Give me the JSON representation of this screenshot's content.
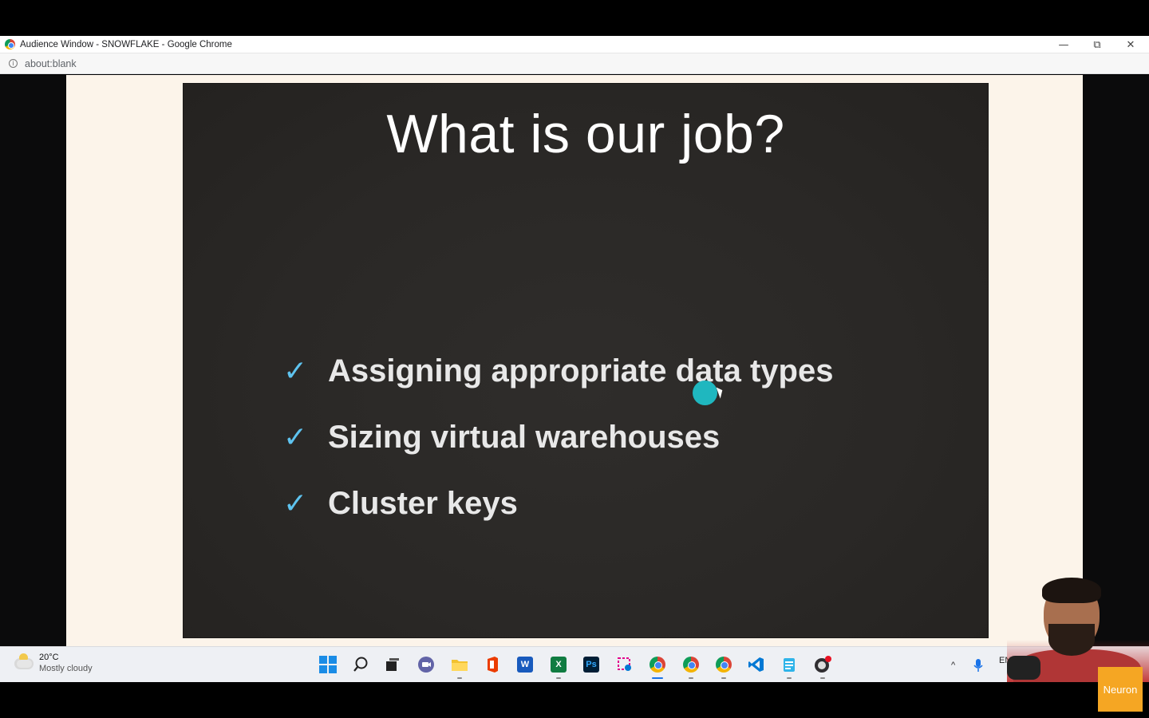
{
  "window": {
    "title": "Audience Window - SNOWFLAKE - Google Chrome",
    "url": "about:blank",
    "minimize_glyph": "—",
    "maximize_glyph": "⧉",
    "close_glyph": "✕"
  },
  "slide": {
    "title": "What is our job?",
    "bullets": [
      {
        "check": "✓",
        "text": "Assigning appropriate data types"
      },
      {
        "check": "✓",
        "text": "Sizing virtual warehouses"
      },
      {
        "check": "✓",
        "text": "Cluster keys"
      }
    ]
  },
  "taskbar": {
    "weather": {
      "temp": "20°C",
      "desc": "Mostly cloudy",
      "icon": "partly-cloudy-icon"
    },
    "apps": [
      {
        "name": "start",
        "icon": "windows-logo-icon"
      },
      {
        "name": "search",
        "icon": "search-icon"
      },
      {
        "name": "task-view",
        "icon": "task-view-icon"
      },
      {
        "name": "teams-chat",
        "icon": "chat-icon"
      },
      {
        "name": "file-explorer",
        "icon": "folder-icon"
      },
      {
        "name": "office",
        "icon": "office-icon"
      },
      {
        "name": "word",
        "icon": "word-icon",
        "label": "W"
      },
      {
        "name": "excel",
        "icon": "excel-icon",
        "label": "X"
      },
      {
        "name": "photoshop",
        "icon": "photoshop-icon",
        "label": "Ps"
      },
      {
        "name": "snipping-tool",
        "icon": "snipping-icon"
      },
      {
        "name": "chrome-1",
        "icon": "chrome-icon"
      },
      {
        "name": "chrome-2",
        "icon": "chrome-icon"
      },
      {
        "name": "chrome-3",
        "icon": "chrome-icon"
      },
      {
        "name": "vscode",
        "icon": "vscode-icon"
      },
      {
        "name": "notepad",
        "icon": "notepad-icon"
      },
      {
        "name": "obs",
        "icon": "obs-icon"
      }
    ],
    "tray": {
      "chevron": "^",
      "language": "ENG"
    }
  },
  "overlay": {
    "brand": "Neuron"
  },
  "colors": {
    "slide_bg": "#2a2826",
    "check": "#5ec3ef",
    "pointer": "#1fb7bf",
    "page_bg": "#fcf4ea",
    "brand": "#f5a623"
  }
}
